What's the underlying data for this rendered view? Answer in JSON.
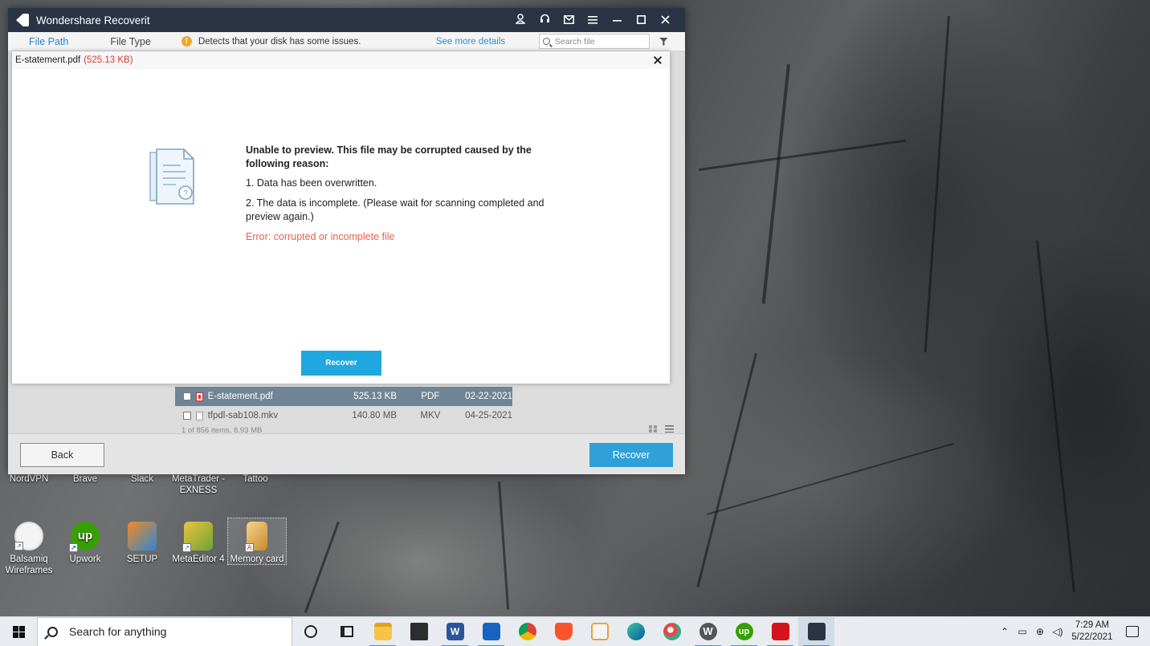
{
  "window": {
    "title": "Wondershare Recoverit",
    "controls": [
      "user",
      "headset",
      "mail",
      "menu",
      "minimize",
      "maximize",
      "close"
    ]
  },
  "toolbar": {
    "tabs": [
      {
        "label": "File Path",
        "active": true
      },
      {
        "label": "File Type",
        "active": false
      }
    ],
    "warning_text": "Detects that your disk has some issues.",
    "see_more_label": "See more details",
    "search_placeholder": "Search file"
  },
  "preview": {
    "file_name": "E-statement.pdf",
    "file_size": "(525.13 KB)",
    "heading": "Unable to preview. This file may be corrupted caused by the following reason:",
    "reason_1": "1. Data has been overwritten.",
    "reason_2": "2. The data is incomplete. (Please wait for scanning completed and preview again.)",
    "error": "Error: corrupted or incomplete file",
    "recover_label": "Recover"
  },
  "files": [
    {
      "name": "E-statement.pdf",
      "size": "525.13 KB",
      "type": "PDF",
      "date": "02-22-2021",
      "selected": true
    },
    {
      "name": "tfpdl-sab108.mkv",
      "size": "140.80 MB",
      "type": "MKV",
      "date": "04-25-2021",
      "selected": false
    }
  ],
  "items_info": "1 of 856 items, 8.93 MB",
  "footer": {
    "back_label": "Back",
    "recover_label": "Recover"
  },
  "desktop_icons": [
    {
      "label": "NordVPN"
    },
    {
      "label": "Brave"
    },
    {
      "label": "Slack"
    },
    {
      "label": "MetaTrader - EXNESS"
    },
    {
      "label": "Tattoo"
    },
    {
      "label": "Balsamiq Wireframes"
    },
    {
      "label": "Upwork"
    },
    {
      "label": "SETUP"
    },
    {
      "label": "MetaEditor 4"
    },
    {
      "label": "Memory card"
    }
  ],
  "taskbar": {
    "search_placeholder": "Search for anything",
    "apps": [
      "cortana",
      "task-view",
      "file-explorer",
      "store",
      "word",
      "search-app",
      "chrome",
      "brave",
      "media",
      "edge",
      "paint",
      "wondershare",
      "upwork",
      "acrobat",
      "recoverit"
    ],
    "time": "7:29 AM",
    "date": "5/22/2021",
    "colors": {
      "accent": "#4a8fd6"
    }
  }
}
